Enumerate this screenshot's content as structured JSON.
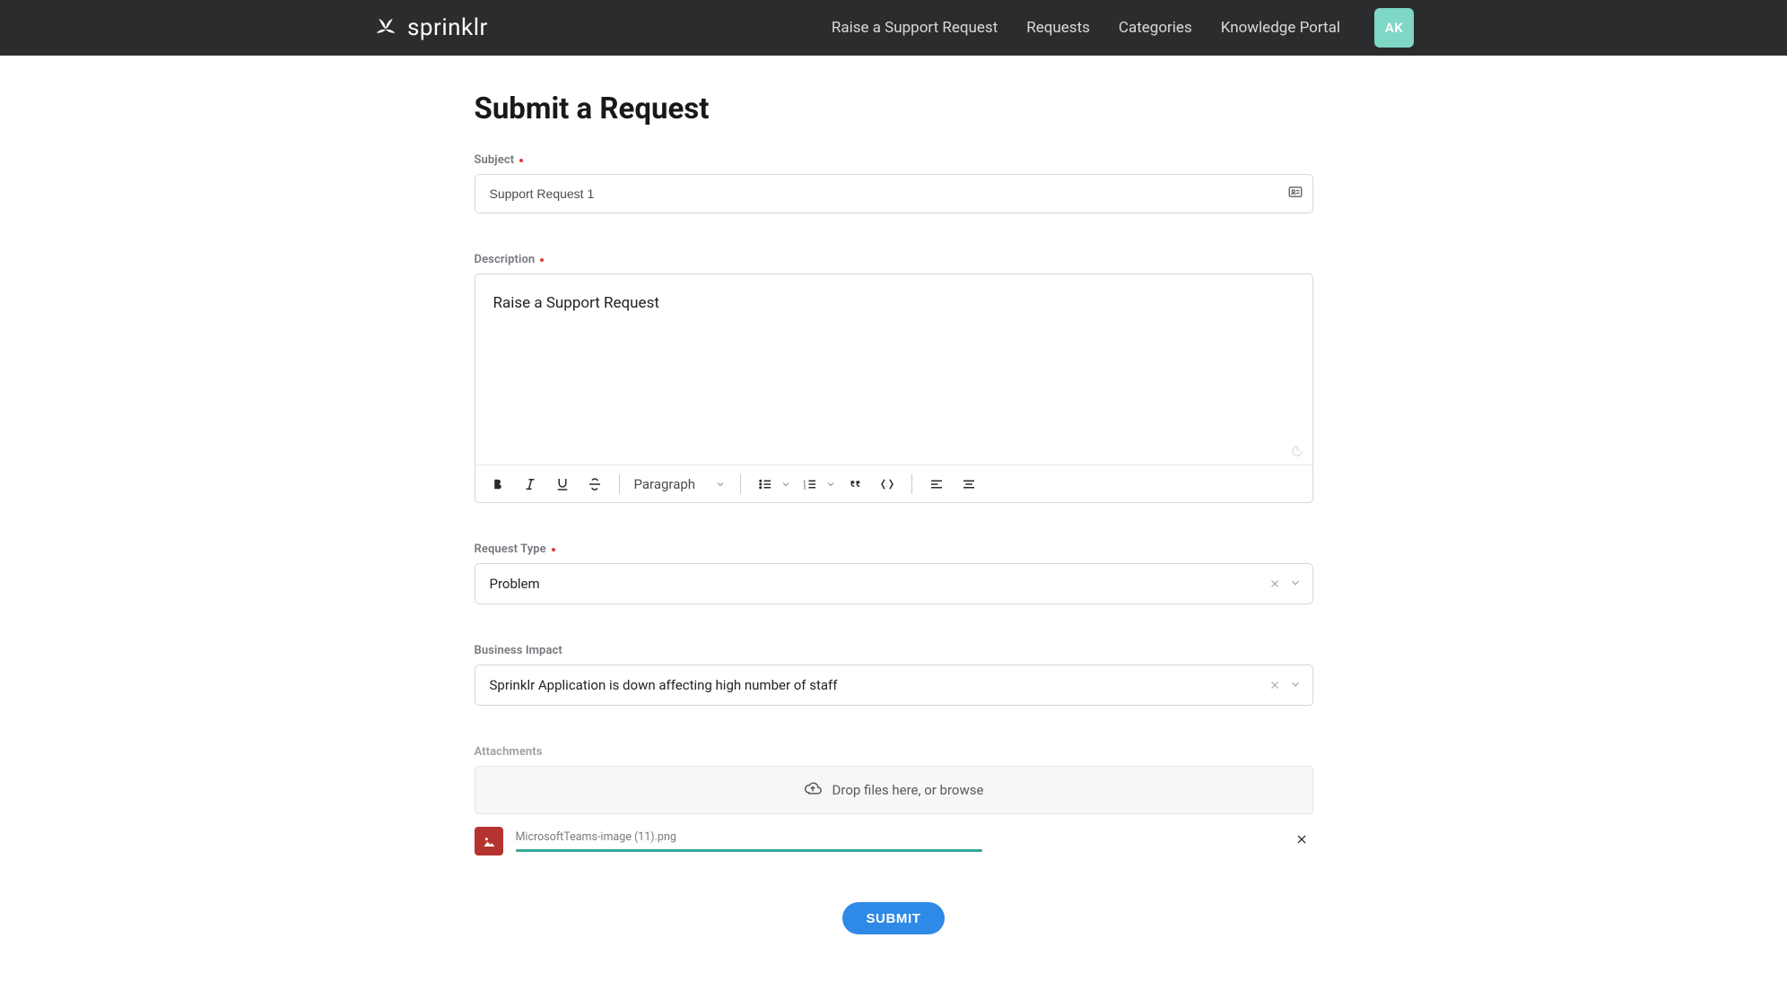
{
  "header": {
    "brand": "sprinklr",
    "nav": {
      "raise": "Raise a Support Request",
      "requests": "Requests",
      "categories": "Categories",
      "knowledge": "Knowledge Portal"
    },
    "user_initials": "AK"
  },
  "page": {
    "title": "Submit a Request"
  },
  "subject": {
    "label": "Subject",
    "value": "Support Request 1"
  },
  "description": {
    "label": "Description",
    "value": "Raise a Support Request"
  },
  "editor": {
    "paragraph_select": "Paragraph"
  },
  "request_type": {
    "label": "Request Type",
    "value": "Problem"
  },
  "business_impact": {
    "label": "Business Impact",
    "value": "Sprinklr Application is down affecting high number of staff"
  },
  "attachments": {
    "label": "Attachments",
    "dropzone_text": "Drop files here, or browse",
    "file": {
      "name": "MicrosoftTeams-image (11).png",
      "progress_pct": 100
    }
  },
  "submit_label": "SUBMIT"
}
